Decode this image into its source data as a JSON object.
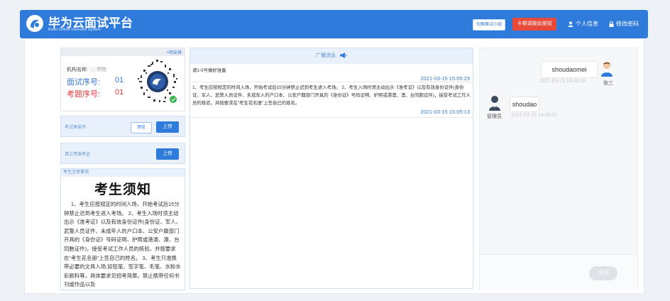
{
  "header": {
    "brand_title": "毕为云面试平台",
    "brand_subtitle": "Biwei Online Interview System",
    "switch_button": "切换面试小组",
    "stuck_button": "卡顿请按此按钮",
    "profile_link": "个人信息",
    "password_link": "修改密码",
    "colors": {
      "header_bg": "#2e7bdc",
      "danger": "#e84a3a"
    }
  },
  "info": {
    "pending_link": "+待安排",
    "org_label": "机构名称:",
    "org_value": "学院",
    "seat_label": "面试序号:",
    "seat_value": "01",
    "paper_label": "考题序号:",
    "paper_value": "01"
  },
  "commitment": {
    "label": "考试承诺书",
    "preview_button": "预览",
    "upload_button": "上传"
  },
  "admission": {
    "label": "请上传准考证",
    "upload_button": "上传"
  },
  "notice": {
    "header": "考生注意事项",
    "title": "考生须知",
    "body": "1、考生应按规定的时间入场，开始考试后15分钟禁止迟到考生进入考场。 2、考生入场时须主动出示《准考证》以及有效身份证件(身份证、军人、武警人员证件、未成年人的户口本、公安户籍部门开具的《身份证》号码证明、护照或港澳、澳、台同胞证件)，接受考试工作人员的核验，并按要求在“考生花名册”上签自己的姓名。 3、考生只准携带必要的文具入场,如铅笔、签字笔、毛笔、水粉水彩颜料等，具体要求见招考简章。禁止携带任何书刊或作品以及"
  },
  "broadcast": {
    "header": "广播消息",
    "messages": [
      {
        "text": "请1-5号做好准备",
        "time": "2021-03-15 15:05:29"
      },
      {
        "text": "1、考生应按规定的时间入场，开始考试后15分钟禁止迟到考生进入考场。 2、考生入场时须主动出示《准考证》以及有效身份证件(身份证、军人、武警人员证件、未成年人的户口本、公安户籍部门开具的《身份证》号码证明、护照或港澳、澳、台同胞证件)，接受考试工作人员的核验，并按要求在“考生花名册”上签自己的姓名。",
        "time": "2021-03-15 15:05:13"
      }
    ]
  },
  "chat": {
    "messages": [
      {
        "side": "right",
        "text": "shoudaomei",
        "time": "2021-03-15 14:45:08",
        "sender": "张三"
      },
      {
        "side": "left",
        "text": "shoudao",
        "time": "2021-03-15 14:45:20",
        "sender": "管理员"
      }
    ],
    "send_button": "发送",
    "input_value": ""
  }
}
